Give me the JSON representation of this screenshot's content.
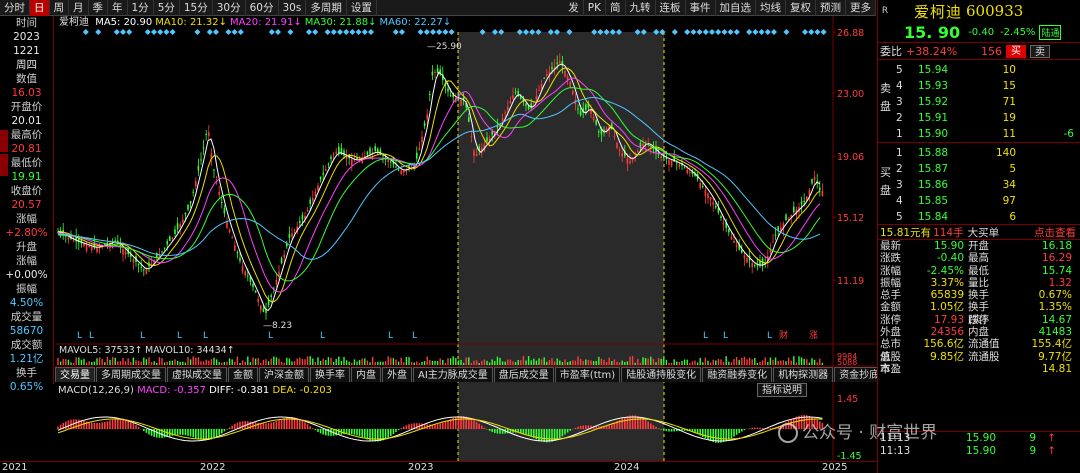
{
  "toolbar": {
    "left_items": [
      "分时",
      "日",
      "周",
      "月",
      "季",
      "年",
      "1分",
      "5分",
      "15分",
      "30分",
      "60分",
      "30s",
      "多周期",
      "设置"
    ],
    "active_item": "日",
    "right_items": [
      "发",
      "PK",
      "简",
      "九转",
      "连板",
      "事件",
      "加自选",
      "均线",
      "复权",
      "预测",
      "更多"
    ]
  },
  "left_panel": [
    {
      "text": "时间",
      "color": "label"
    },
    {
      "text": "2023",
      "color": "white"
    },
    {
      "text": "1221",
      "color": "white"
    },
    {
      "text": "周四",
      "color": "white"
    },
    {
      "text": "数值",
      "color": "label"
    },
    {
      "text": "16.03",
      "color": "red"
    },
    {
      "text": "开盘价",
      "color": "label"
    },
    {
      "text": "20.01",
      "color": "white"
    },
    {
      "text": "最高价",
      "color": "label"
    },
    {
      "text": "20.81",
      "color": "red"
    },
    {
      "text": "最低价",
      "color": "label"
    },
    {
      "text": "19.91",
      "color": "green"
    },
    {
      "text": "收盘价",
      "color": "label"
    },
    {
      "text": "20.57",
      "color": "red"
    },
    {
      "text": "涨幅",
      "color": "label"
    },
    {
      "text": "+2.80%",
      "color": "red"
    },
    {
      "text": "升盘",
      "color": "label"
    },
    {
      "text": "涨幅",
      "color": "label"
    },
    {
      "text": "+0.00%",
      "color": "white"
    },
    {
      "text": "振幅",
      "color": "label"
    },
    {
      "text": "4.50%",
      "color": "cyan"
    },
    {
      "text": "成交量",
      "color": "label"
    },
    {
      "text": "58670",
      "color": "cyan"
    },
    {
      "text": "成交额",
      "color": "label"
    },
    {
      "text": "1.21亿",
      "color": "cyan"
    },
    {
      "text": "换手",
      "color": "label"
    },
    {
      "text": "0.65%",
      "color": "cyan"
    }
  ],
  "ma_legend": {
    "name": "爱柯迪",
    "items": [
      {
        "label": "MA5: 20.90",
        "color": "#ffffff"
      },
      {
        "label": "MA10: 21.32",
        "color": "#f0e000",
        "arrow": "↓"
      },
      {
        "label": "MA20: 21.91",
        "color": "#ff40ff",
        "arrow": "↓"
      },
      {
        "label": "MA30: 21.88",
        "color": "#33ff33",
        "arrow": "↓"
      },
      {
        "label": "MA60: 22.27",
        "color": "#4fc8ff",
        "arrow": "↓"
      }
    ]
  },
  "price_axis": [
    "26.88",
    "23.00",
    "19.06",
    "15.12",
    "11.19"
  ],
  "price_marks": {
    "high": "25.90",
    "low": "8.23"
  },
  "event_marks": [
    "财",
    "涨"
  ],
  "mavol": {
    "l5": "MAVOL5: 37533",
    "l10": "MAVOL10: 34434"
  },
  "vol_axis": [
    "9984",
    "5088"
  ],
  "indicator_tabs": [
    "交易量",
    "多周期成交量",
    "虚拟成交量",
    "金额",
    "沪深金额",
    "换手率",
    "内盘",
    "外盘",
    "AI主力脉成交量",
    "盘后成交量",
    "市盈率(ttm)",
    "陆股通持股变化",
    "融资融券变化",
    "机构探测器",
    "资金抄底"
  ],
  "indicator_active": "交易量",
  "indicator_help": "指标说明",
  "macd": {
    "label": "MACD(12,26,9)",
    "macd": "MACD: -0.357",
    "diff": "DIFF: -0.381",
    "dea": "DEA: -0.203"
  },
  "macd_axis": [
    "1.45",
    "-1.45"
  ],
  "year_axis": [
    "2021",
    "2022",
    "2023",
    "2024",
    "2025"
  ],
  "right_panel": {
    "flag": "R",
    "name": "爱柯迪",
    "code": "600933",
    "price": "15. 90",
    "change": "-0.40",
    "change_pct": "-2.45%",
    "badge": "陆通",
    "weibi_label": "委比",
    "weibi_value": "+38.24%",
    "weibi_count": "156",
    "buy_btn": "买",
    "sell_btn": "卖",
    "sell_side": "卖盘",
    "buy_side": "买盘",
    "asks": [
      {
        "lv": "5",
        "price": "15.94",
        "vol": "10",
        "extra": ""
      },
      {
        "lv": "4",
        "price": "15.93",
        "vol": "15",
        "extra": ""
      },
      {
        "lv": "3",
        "price": "15.92",
        "vol": "71",
        "extra": ""
      },
      {
        "lv": "2",
        "price": "15.91",
        "vol": "19",
        "extra": ""
      },
      {
        "lv": "1",
        "price": "15.90",
        "vol": "11",
        "extra": "-6"
      }
    ],
    "bids": [
      {
        "lv": "1",
        "price": "15.88",
        "vol": "140",
        "extra": ""
      },
      {
        "lv": "2",
        "price": "15.87",
        "vol": "5",
        "extra": ""
      },
      {
        "lv": "3",
        "price": "15.86",
        "vol": "34",
        "extra": ""
      },
      {
        "lv": "4",
        "price": "15.85",
        "vol": "97",
        "extra": ""
      },
      {
        "lv": "5",
        "price": "15.84",
        "vol": "6",
        "extra": ""
      }
    ],
    "bigorder": {
      "a": "15.81元有",
      "b": "114手",
      "c": "大买单",
      "d": "点击查看"
    },
    "stats": [
      {
        "k1": "最新",
        "v1": "15.90",
        "c1": "#33ff33",
        "k2": "开盘",
        "v2": "16.18",
        "c2": "#33ff33"
      },
      {
        "k1": "涨跌",
        "v1": "-0.40",
        "c1": "#33ff33",
        "k2": "最高",
        "v2": "16.29",
        "c2": "#ff3b3b"
      },
      {
        "k1": "涨幅",
        "v1": "-2.45%",
        "c1": "#33ff33",
        "k2": "最低",
        "v2": "15.74",
        "c2": "#33ff33"
      },
      {
        "k1": "振幅",
        "v1": "3.37%",
        "c1": "#f0e000",
        "k2": "量比",
        "v2": "1.32",
        "c2": "#ff3b3b"
      },
      {
        "k1": "总手",
        "v1": "65839",
        "c1": "#f0e000",
        "k2": "换手",
        "v2": "0.67%",
        "c2": "#f0e000"
      },
      {
        "k1": "金额",
        "v1": "1.05亿",
        "c1": "#f0e000",
        "k2": "换手(实)",
        "v2": "1.35%",
        "c2": "#f0e000"
      },
      {
        "k1": "涨停",
        "v1": "17.93",
        "c1": "#ff3b3b",
        "k2": "跌停",
        "v2": "14.67",
        "c2": "#33ff33"
      },
      {
        "k1": "外盘",
        "v1": "24356",
        "c1": "#ff3b3b",
        "k2": "内盘",
        "v2": "41483",
        "c2": "#33ff33"
      },
      {
        "k1": "总市值",
        "v1": "156.6亿",
        "c1": "#f0e000",
        "k2": "流通值",
        "v2": "155.4亿",
        "c2": "#f0e000"
      },
      {
        "k1": "总股本",
        "v1": "9.85亿",
        "c1": "#f0e000",
        "k2": "流通股",
        "v2": "9.77亿",
        "c2": "#f0e000"
      },
      {
        "k1": "市盈",
        "v1": "",
        "c1": "#f0e000",
        "k2": "",
        "v2": "14.81",
        "c2": "#f0e000"
      }
    ],
    "ticks": [
      {
        "t": "11:13",
        "p": "15.90",
        "q": "9",
        "f": "↑"
      },
      {
        "t": "11:13",
        "p": "15.90",
        "q": "9",
        "f": "↑"
      }
    ]
  },
  "watermark": "公众号 · 财富世界",
  "colors": {
    "up": "#ff3b3b",
    "down": "#33ff33",
    "accent": "#f0e000",
    "border": "#7a0000",
    "highlight": "#2a2a2a"
  }
}
